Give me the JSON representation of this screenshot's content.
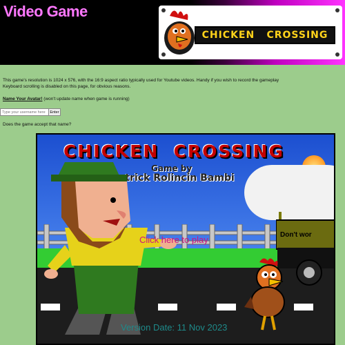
{
  "header": {
    "site_title": "Video Game",
    "banner_logo": [
      "CHICKEN",
      "CROSSING"
    ]
  },
  "info": {
    "line1": "This game's resolution is 1024 x 576, with the 16:9 aspect ratio typically used for Youtube videos. Handy if you wish to record the gameplay",
    "line2": "Keyboard scrolling is disabled on this page, for obvious reasons."
  },
  "avatar": {
    "label": "Name Your Avatar!",
    "note": " (won't update name when game is running)",
    "input_placeholder": "Type your username here",
    "enter_label": "Enter",
    "question": "Does the game accept that name?"
  },
  "game": {
    "title_words": [
      "CHICKEN",
      "CROSSING"
    ],
    "game_by": "Game by",
    "author": "Patrick Rolincin Bambi",
    "click_link": "Click here to play",
    "truck_sign": "Don't wor",
    "version": "Version Date: 11 Nov 2023"
  }
}
